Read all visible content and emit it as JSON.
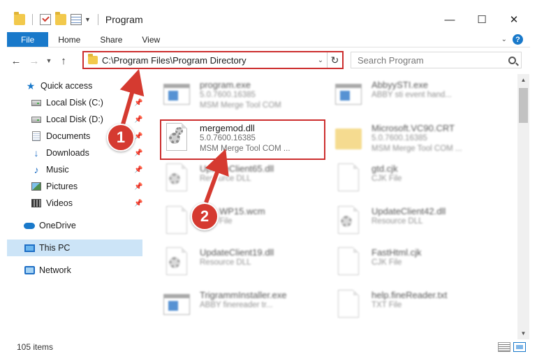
{
  "window": {
    "title": "Program",
    "controls": {
      "minimize": "—",
      "maximize": "☐",
      "close": "✕"
    }
  },
  "ribbon": {
    "tabs": [
      "File",
      "Home",
      "Share",
      "View"
    ],
    "help": "?"
  },
  "address": {
    "path": "C:\\Program Files\\Program Directory",
    "search_placeholder": "Search Program"
  },
  "sidebar": {
    "items": [
      {
        "label": "Quick access",
        "icon": "star-icon",
        "pinned": false
      },
      {
        "label": "Local Disk (C:)",
        "icon": "disk-icon",
        "pinned": true
      },
      {
        "label": "Local Disk (D:)",
        "icon": "disk-icon",
        "pinned": true
      },
      {
        "label": "Documents",
        "icon": "documents-icon",
        "pinned": true
      },
      {
        "label": "Downloads",
        "icon": "downloads-icon",
        "pinned": true
      },
      {
        "label": "Music",
        "icon": "music-icon",
        "pinned": true
      },
      {
        "label": "Pictures",
        "icon": "pictures-icon",
        "pinned": true
      },
      {
        "label": "Videos",
        "icon": "videos-icon",
        "pinned": true
      },
      {
        "label": "OneDrive",
        "icon": "onedrive-icon",
        "pinned": false
      },
      {
        "label": "This PC",
        "icon": "this-pc-icon",
        "pinned": false,
        "selected": true
      },
      {
        "label": "Network",
        "icon": "network-icon",
        "pinned": false
      }
    ]
  },
  "files": [
    {
      "name": "program.exe",
      "line1": "5.0.7600.16385",
      "line2": "MSM Merge Tool COM",
      "type": "exe"
    },
    {
      "name": "AbbyySTI.exe",
      "line1": "ABBY sti event hand...",
      "line2": "",
      "type": "exe"
    },
    {
      "name": "mergemod.dll",
      "line1": "5.0.7600.16385",
      "line2": "MSM Merge Tool COM ...",
      "type": "dll",
      "highlighted": true
    },
    {
      "name": "Microsoft.VC90.CRT",
      "line1": "5.0.7600.16385",
      "line2": "MSM Merge Tool COM ...",
      "type": "folder"
    },
    {
      "name": "UpdateClient65.dll",
      "line1": "Resource DLL",
      "line2": "",
      "type": "dll"
    },
    {
      "name": "gtd.cjk",
      "line1": "CJK File",
      "line2": "",
      "type": "file"
    },
    {
      "name": "WP15.wcm",
      "line1": "File",
      "line2": "",
      "type": "file"
    },
    {
      "name": "UpdateClient42.dll",
      "line1": "Resource DLL",
      "line2": "",
      "type": "dll"
    },
    {
      "name": "UpdateClient19.dll",
      "line1": "Resource DLL",
      "line2": "",
      "type": "dll"
    },
    {
      "name": "FastHtml.cjk",
      "line1": "CJK File",
      "line2": "",
      "type": "file"
    },
    {
      "name": "TrigrammInstaller.exe",
      "line1": "ABBY finereader tr...",
      "line2": "",
      "type": "exe"
    },
    {
      "name": "help.fineReader.txt",
      "line1": "TXT File",
      "line2": "",
      "type": "file"
    }
  ],
  "status": {
    "count": "105 items"
  },
  "steps": [
    "1",
    "2"
  ],
  "colors": {
    "accent": "#1979ca",
    "highlight": "#cc2d2d",
    "badge": "#d53a30"
  }
}
